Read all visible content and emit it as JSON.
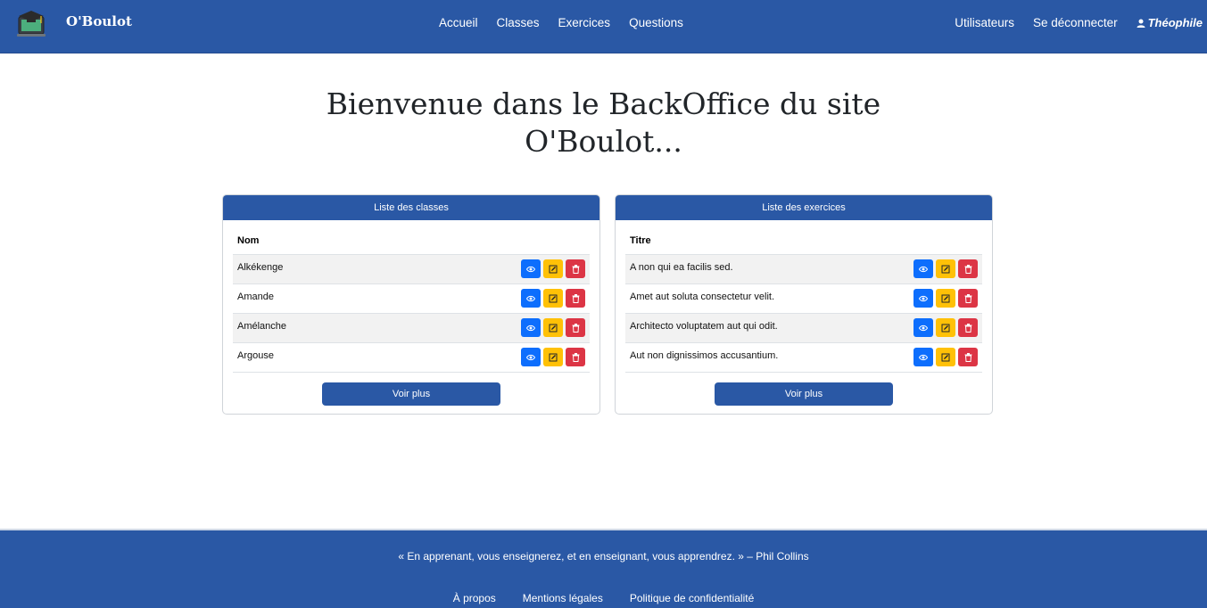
{
  "brand": {
    "name": "O'Boulot",
    "logo_icon": "graduation-laptop-icon"
  },
  "nav": {
    "center": [
      "Accueil",
      "Classes",
      "Exercices",
      "Questions"
    ],
    "right": [
      "Utilisateurs",
      "Se déconnecter"
    ],
    "user": "Théophile"
  },
  "hero": {
    "title": "Bienvenue dans le BackOffice du site O'Boulot..."
  },
  "classes": {
    "header": "Liste des classes",
    "column": "Nom",
    "rows": [
      "Alkékenge",
      "Amande",
      "Amélanche",
      "Argouse"
    ],
    "more": "Voir plus"
  },
  "exercices": {
    "header": "Liste des exercices",
    "column": "Titre",
    "rows": [
      "A non qui ea facilis sed.",
      "Amet aut soluta consectetur velit.",
      "Architecto voluptatem aut qui odit.",
      "Aut non dignissimos accusantium."
    ],
    "more": "Voir plus"
  },
  "footer": {
    "quote": "« En apprenant, vous enseignerez, et en enseignant, vous apprendrez. » – Phil Collins",
    "links": [
      "À propos",
      "Mentions légales",
      "Politique de confidentialité"
    ]
  },
  "colors": {
    "primary": "#2a58a5",
    "view": "#0d6efd",
    "edit": "#ffc107",
    "delete": "#dc3545"
  },
  "icons": {
    "view": "eye-icon",
    "edit": "edit-icon",
    "delete": "trash-icon",
    "user": "user-icon"
  }
}
